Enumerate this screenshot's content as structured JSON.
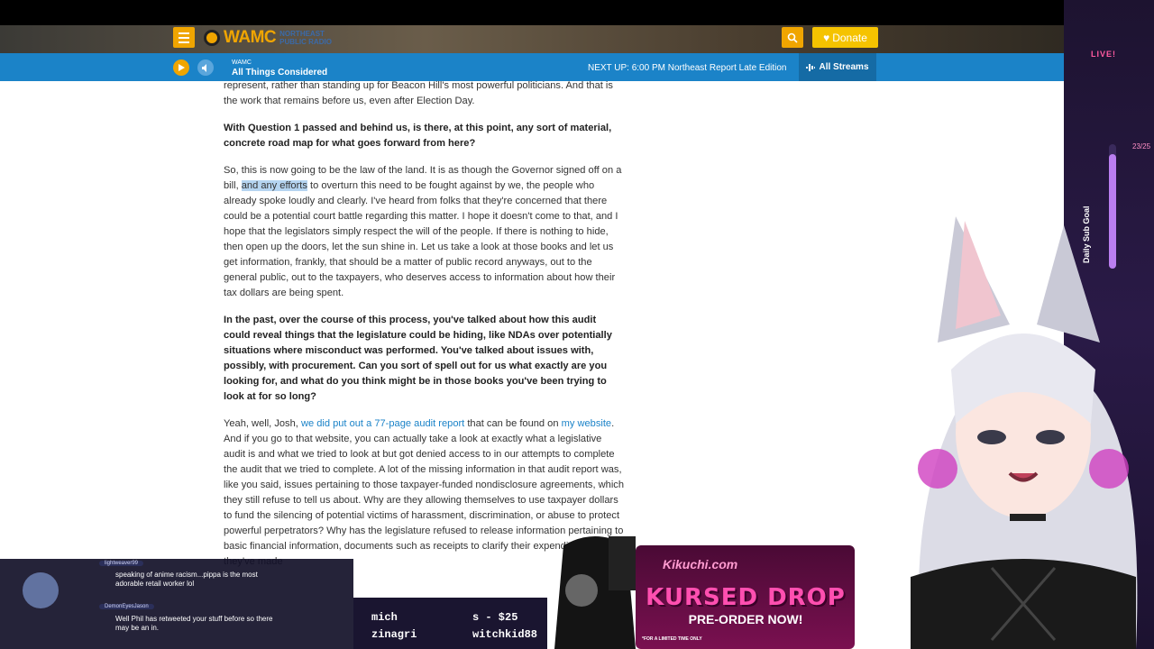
{
  "site": {
    "logo_text": "WAMC",
    "logo_sub": "NORTHEAST PUBLIC RADIO",
    "donate_label": "Donate"
  },
  "player": {
    "station": "WAMC",
    "program": "All Things Considered",
    "next_up": "NEXT UP: 6:00 PM Northeast Report Late Edition",
    "streams_label": "All Streams"
  },
  "article": {
    "p0": "represent, rather than standing up for Beacon Hill's most powerful politicians. And that is the work that remains before us, even after Election Day.",
    "q1": "With Question 1 passed and behind us, is there, at this point, any sort of material, concrete road map for what goes forward from here?",
    "a1_pre": "So, this is now going to be the law of the land. It is as though the Governor signed off on a bill, ",
    "a1_hl": "and any efforts",
    "a1_post": " to overturn this need to be fought against by we, the people who already spoke loudly and clearly. I've heard from folks that they're concerned that there could be a potential court battle regarding this matter. I hope it doesn't come to that, and I hope that the legislators simply respect the will of the people. If there is nothing to hide, then open up the doors, let the sun shine in. Let us take a look at those books and let us get information, frankly, that should be a matter of public record anyways, out to the general public, out to the taxpayers, who deserves access to information about how their tax dollars are being spent.",
    "q2": "In the past, over the course of this process, you've talked about how this audit could reveal things that the legislature could be hiding, like NDAs over potentially situations where misconduct was performed. You've talked about issues with, possibly, with procurement. Can you sort of spell out for us what exactly are you looking for, and what do you think might be in those books you've been trying to look at for so long?",
    "a2_pre": "Yeah, well, Josh, ",
    "a2_link1": "we did put out a 77-page audit report",
    "a2_mid": " that can be found on ",
    "a2_link2": "my website",
    "a2_post": ". And if you go to that website, you can actually take a look at exactly what a legislative audit is and what we tried to look at but got denied access to in our attempts to complete the audit that we tried to complete. A lot of the missing information in that audit report was, like you said, issues pertaining to those taxpayer-funded nondisclosure agreements, which they still refuse to tell us about. Why are they allowing themselves to use taxpayer dollars to fund the silencing of potential victims of harassment, discrimination, or abuse to protect powerful perpetrators? Why has the legislature refused to release information pertaining to basic financial information, documents such as receipts to clarify their expenditures that they've made"
  },
  "overlay": {
    "live": "LIVE!",
    "sub_goal_label": "Daily Sub Goal",
    "sub_goal_count": "23/25",
    "sub_goal_fraction": 0.92,
    "chat": [
      {
        "user": "lightweaver99",
        "text": "speaking of anime racism...pippa is the most adorable retail worker lol"
      },
      {
        "user": "DemonEyesJason",
        "text": "Well Phil has retweeted your stuff before so there may be an in."
      }
    ],
    "tickers": [
      "mich",
      "s - $25",
      "zinagri",
      "witchkid88"
    ],
    "promo_site": "Kikuchi.com",
    "promo_title": "KURSED DROP",
    "promo_cta": "PRE-ORDER NOW!",
    "promo_foot": "*FOR A LIMITED TIME ONLY"
  },
  "colors": {
    "accent": "#f0a500",
    "player_bg": "#1b83c8",
    "link": "#1b83c8"
  }
}
